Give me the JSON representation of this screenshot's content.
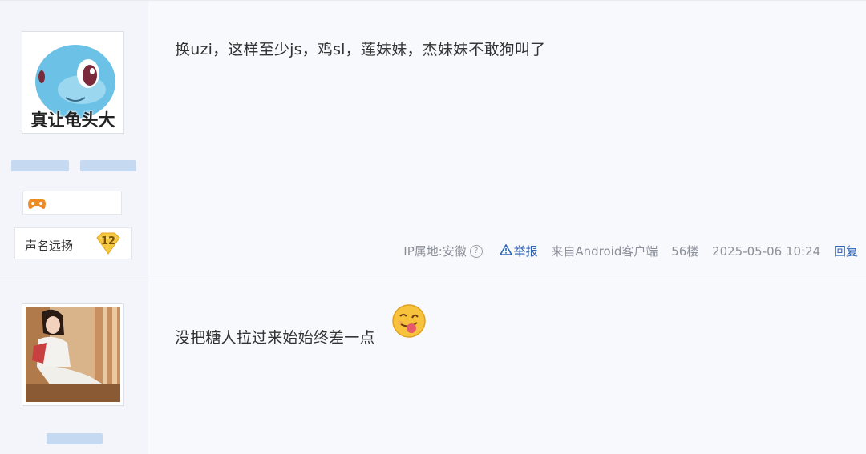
{
  "posts": [
    {
      "avatar_caption": "真让龟头大",
      "rank": {
        "title": "声名远扬",
        "level": "12"
      },
      "content": "换uzi，这样至少js，鸡sl，莲妹妹，杰妹妹不敢狗叫了",
      "tail": {
        "ip": "IP属地:安徽",
        "report": "举报",
        "client": "来自Android客户端",
        "floor": "56楼",
        "time": "2025-05-06 10:24",
        "reply": "回复"
      }
    },
    {
      "content": "没把糖人拉过来始始终差一点"
    }
  ],
  "colors": {
    "link": "#2d64b3",
    "muted": "#8a8f99",
    "level_badge": "#f5c842"
  },
  "icons": [
    "squirtle-avatar",
    "person-photo-avatar",
    "game-controller-icon",
    "level-badge-icon",
    "help-icon",
    "warning-icon",
    "tongue-emoji-icon"
  ]
}
